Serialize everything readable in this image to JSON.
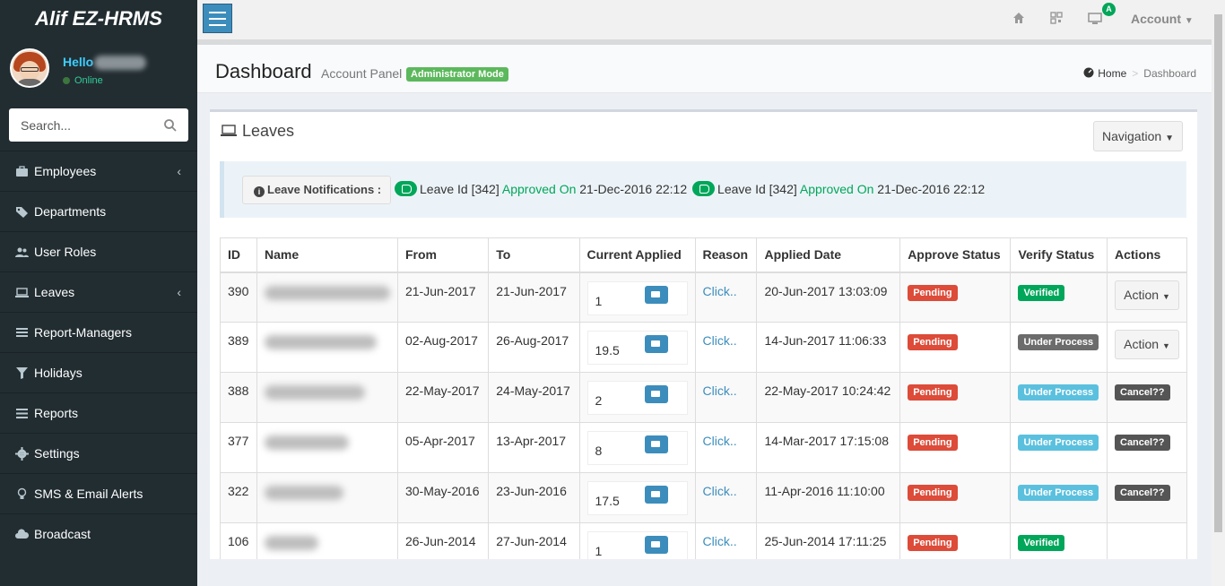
{
  "app": {
    "logo": "Alif EZ-HRMS"
  },
  "user": {
    "hello": "Hello",
    "status": "Online"
  },
  "search": {
    "placeholder": "Search..."
  },
  "sidebar": {
    "items": [
      {
        "label": "Employees",
        "icon": "briefcase-icon",
        "chevron": "‹"
      },
      {
        "label": "Departments",
        "icon": "tags-icon"
      },
      {
        "label": "User Roles",
        "icon": "users-icon"
      },
      {
        "label": "Leaves",
        "icon": "laptop-icon",
        "chevron": "‹"
      },
      {
        "label": "Report-Managers",
        "icon": "list-icon"
      },
      {
        "label": "Holidays",
        "icon": "filter-icon"
      },
      {
        "label": "Reports",
        "icon": "lines-icon"
      },
      {
        "label": "Settings",
        "icon": "gear-icon"
      },
      {
        "label": "SMS & Email Alerts",
        "icon": "lightbulb-icon"
      },
      {
        "label": "Broadcast",
        "icon": "cloud-icon"
      }
    ]
  },
  "header": {
    "account_label": "Account",
    "notification_badge": "A"
  },
  "page": {
    "title": "Dashboard",
    "subtitle": "Account Panel",
    "mode_badge": "Administrator Mode",
    "breadcrumb": {
      "home": "Home",
      "sep": ">",
      "current": "Dashboard"
    }
  },
  "leaves_box": {
    "title": "Leaves",
    "nav_button": "Navigation",
    "notifications_button": "Leave Notifications :",
    "notifications": [
      {
        "prefix": "Leave Id [342]",
        "status": "Approved On",
        "date": "21-Dec-2016 22:12"
      },
      {
        "prefix": "Leave Id [342]",
        "status": "Approved On",
        "date": "21-Dec-2016 22:12"
      }
    ]
  },
  "table": {
    "headers": [
      "ID",
      "Name",
      "From",
      "To",
      "Current Applied",
      "Reason",
      "Applied Date",
      "Approve Status",
      "Verify Status",
      "Actions"
    ],
    "rows": [
      {
        "id": "390",
        "from": "21-Jun-2017",
        "to": "21-Jun-2017",
        "applied": "1",
        "reason": "Click..",
        "applied_date": "20-Jun-2017 13:03:09",
        "approve": "Pending",
        "verify": "Verified",
        "action": "Action"
      },
      {
        "id": "389",
        "from": "02-Aug-2017",
        "to": "26-Aug-2017",
        "applied": "19.5",
        "reason": "Click..",
        "applied_date": "14-Jun-2017 11:06:33",
        "approve": "Pending",
        "verify": "Under Process",
        "action": "Action"
      },
      {
        "id": "388",
        "from": "22-May-2017",
        "to": "24-May-2017",
        "applied": "2",
        "reason": "Click..",
        "applied_date": "22-May-2017 10:24:42",
        "approve": "Pending",
        "verify": "Under Process",
        "action": "Cancel??"
      },
      {
        "id": "377",
        "from": "05-Apr-2017",
        "to": "13-Apr-2017",
        "applied": "8",
        "reason": "Click..",
        "applied_date": "14-Mar-2017 17:15:08",
        "approve": "Pending",
        "verify": "Under Process",
        "action": "Cancel??"
      },
      {
        "id": "322",
        "from": "30-May-2016",
        "to": "23-Jun-2016",
        "applied": "17.5",
        "reason": "Click..",
        "applied_date": "11-Apr-2016 11:10:00",
        "approve": "Pending",
        "verify": "Under Process",
        "action": "Cancel??"
      },
      {
        "id": "106",
        "from": "26-Jun-2014",
        "to": "27-Jun-2014",
        "applied": "1",
        "reason": "Click..",
        "applied_date": "25-Jun-2014 17:11:25",
        "approve": "Pending",
        "verify": "Verified",
        "action": ""
      }
    ]
  },
  "colors": {
    "sidebar": "#222d32",
    "primary": "#3c8dbc",
    "success": "#00a65a",
    "danger": "#dd4b39",
    "info": "#5bc0de"
  }
}
